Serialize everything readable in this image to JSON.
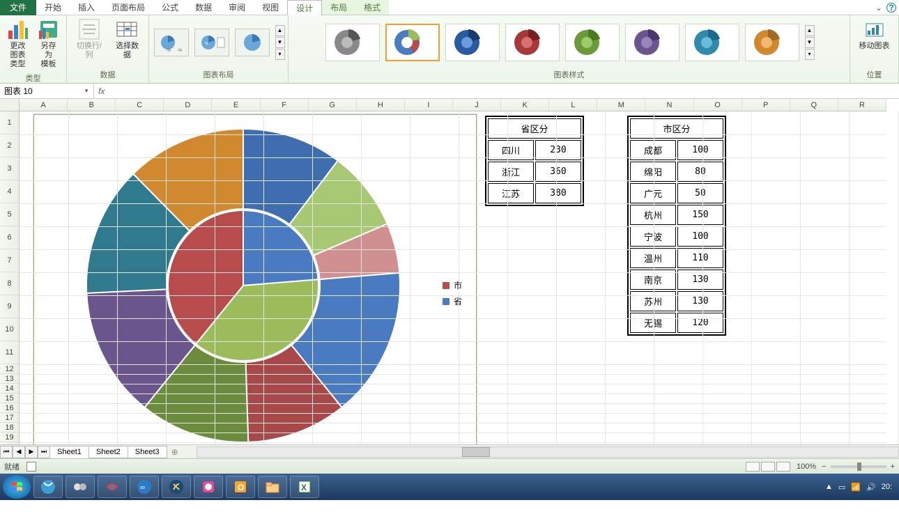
{
  "tabs": {
    "file": "文件",
    "items": [
      "开始",
      "插入",
      "页面布局",
      "公式",
      "数据",
      "审阅",
      "视图"
    ],
    "ctx": [
      "设计",
      "布局",
      "格式"
    ]
  },
  "ribbon": {
    "change_type": "更改\n图表类型",
    "save_tpl": "另存为\n模板",
    "switch_rc": "切换行/列",
    "select_data": "选择数据",
    "group_type": "类型",
    "group_data": "数据",
    "group_layout": "图表布局",
    "group_style": "图表样式",
    "move_chart": "移动图表",
    "group_pos": "位置"
  },
  "namebox": "图表 10",
  "columns": [
    "A",
    "B",
    "C",
    "D",
    "E",
    "F",
    "G",
    "H",
    "I",
    "J",
    "K",
    "L",
    "M",
    "N",
    "O",
    "P",
    "Q",
    "R"
  ],
  "legend": {
    "s1": "市",
    "s2": "省"
  },
  "table_province": {
    "title": "省区分",
    "rows": [
      [
        "四川",
        "230"
      ],
      [
        "浙江",
        "360"
      ],
      [
        "江苏",
        "380"
      ]
    ]
  },
  "table_city": {
    "title": "市区分",
    "rows": [
      [
        "成都",
        "100"
      ],
      [
        "绵阳",
        "80"
      ],
      [
        "广元",
        "50"
      ],
      [
        "杭州",
        "150"
      ],
      [
        "宁波",
        "100"
      ],
      [
        "温州",
        "110"
      ],
      [
        "南京",
        "130"
      ],
      [
        "苏州",
        "130"
      ],
      [
        "无锡",
        "120"
      ]
    ]
  },
  "sheets": [
    "Sheet1",
    "Sheet2",
    "Sheet3"
  ],
  "status": {
    "ready": "就绪",
    "zoom": "100%"
  },
  "taskbar_time": "20:",
  "chart_data": [
    {
      "type": "pie",
      "title": "",
      "series_name": "省",
      "categories": [
        "四川",
        "浙江",
        "江苏"
      ],
      "values": [
        230,
        360,
        380
      ],
      "colors": [
        "#4a7abf",
        "#9cbb5a",
        "#b84c4c"
      ]
    },
    {
      "type": "pie",
      "title": "",
      "series_name": "市",
      "categories": [
        "成都",
        "绵阳",
        "广元",
        "杭州",
        "宁波",
        "温州",
        "南京",
        "苏州",
        "无锡"
      ],
      "values": [
        100,
        80,
        50,
        150,
        100,
        110,
        130,
        130,
        120
      ],
      "colors": [
        "#3f6eb0",
        "#a8c874",
        "#d19090",
        "#4a7abf",
        "#a84848",
        "#6a8c3c",
        "#6a568c",
        "#2f7a8c",
        "#d1892f"
      ]
    }
  ]
}
